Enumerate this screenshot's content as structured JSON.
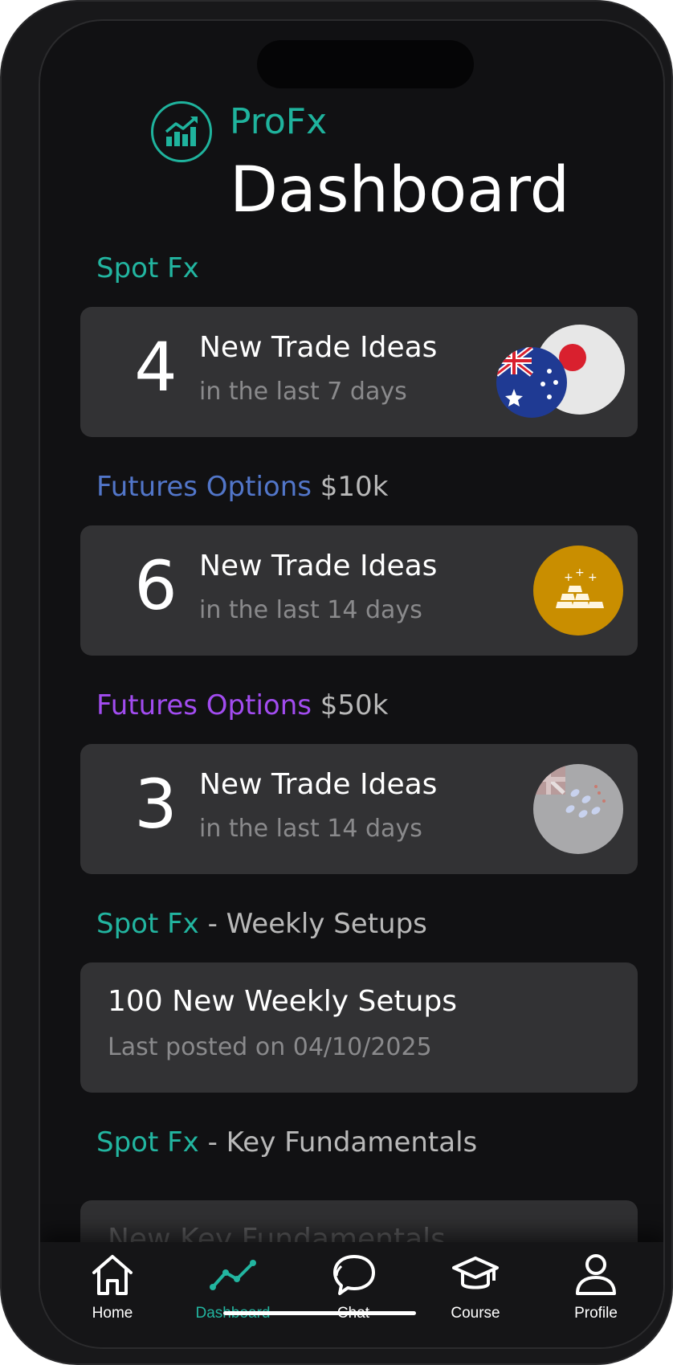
{
  "app": {
    "brand": "ProFx",
    "title": "Dashboard"
  },
  "sections": [
    {
      "label_primary": "Spot Fx",
      "label_secondary": "",
      "card": {
        "count": "4",
        "title": "New Trade Ideas",
        "subtitle": "in the last 7 days",
        "icon": "aud-jpy-flags-icon"
      }
    },
    {
      "label_primary": "Futures Options",
      "label_secondary": "$10k",
      "card": {
        "count": "6",
        "title": "New Trade Ideas",
        "subtitle": "in the last 14 days",
        "icon": "gold-bars-icon"
      }
    },
    {
      "label_primary": "Futures Options",
      "label_secondary": "$50k",
      "card": {
        "count": "3",
        "title": "New Trade Ideas",
        "subtitle": "in the last 14 days",
        "icon": "faded-asset-icon"
      }
    },
    {
      "label_primary": "Spot Fx",
      "label_secondary": "- Weekly Setups",
      "card": {
        "title": "100 New Weekly Setups",
        "subtitle": "Last posted on 04/10/2025"
      }
    },
    {
      "label_primary": "Spot Fx",
      "label_secondary": "- Key Fundamentals",
      "card": {
        "title": "New Key Fundamentals"
      }
    }
  ],
  "tabbar": [
    {
      "label": "Home",
      "icon": "home-icon",
      "active": false
    },
    {
      "label": "Dashboard",
      "icon": "trend-line-icon",
      "active": true
    },
    {
      "label": "Chat",
      "icon": "chat-bubbles-icon",
      "active": false
    },
    {
      "label": "Course",
      "icon": "graduation-cap-icon",
      "active": false
    },
    {
      "label": "Profile",
      "icon": "user-icon",
      "active": false
    }
  ],
  "colors": {
    "accent_teal": "#22b5a0",
    "futures_10k_blue": "#5276c9",
    "futures_50k_purple": "#a24cf0",
    "card_bg": "#323234",
    "gold": "#c98e00"
  }
}
